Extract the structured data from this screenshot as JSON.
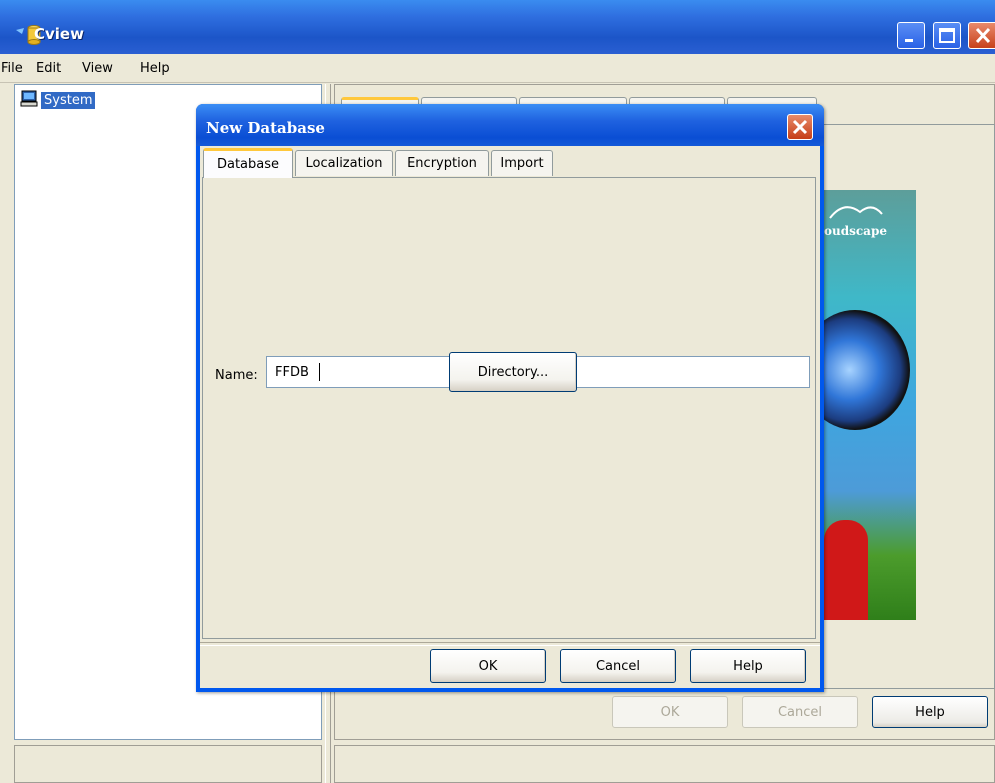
{
  "window": {
    "title": "Cview",
    "menu": [
      "File",
      "Edit",
      "View",
      "Help"
    ]
  },
  "tree": {
    "items": [
      {
        "label": "System",
        "icon": "computer-icon"
      }
    ]
  },
  "background": {
    "splash_text": "oudscape",
    "buttons": {
      "ok": "OK",
      "cancel": "Cancel",
      "help": "Help"
    }
  },
  "dialog": {
    "title": "New Database",
    "tabs": [
      "Database",
      "Localization",
      "Encryption",
      "Import"
    ],
    "active_tab": "Database",
    "name_label": "Name:",
    "name_value": "FFDB",
    "directory_button": "Directory...",
    "buttons": {
      "ok": "OK",
      "cancel": "Cancel",
      "help": "Help"
    }
  },
  "colors": {
    "titlebar": "#2f6fe0",
    "selection": "#316ac5",
    "window_bg": "#ece9d8",
    "close_button": "#c53d17",
    "active_tab_accent": "#ffc83c"
  }
}
